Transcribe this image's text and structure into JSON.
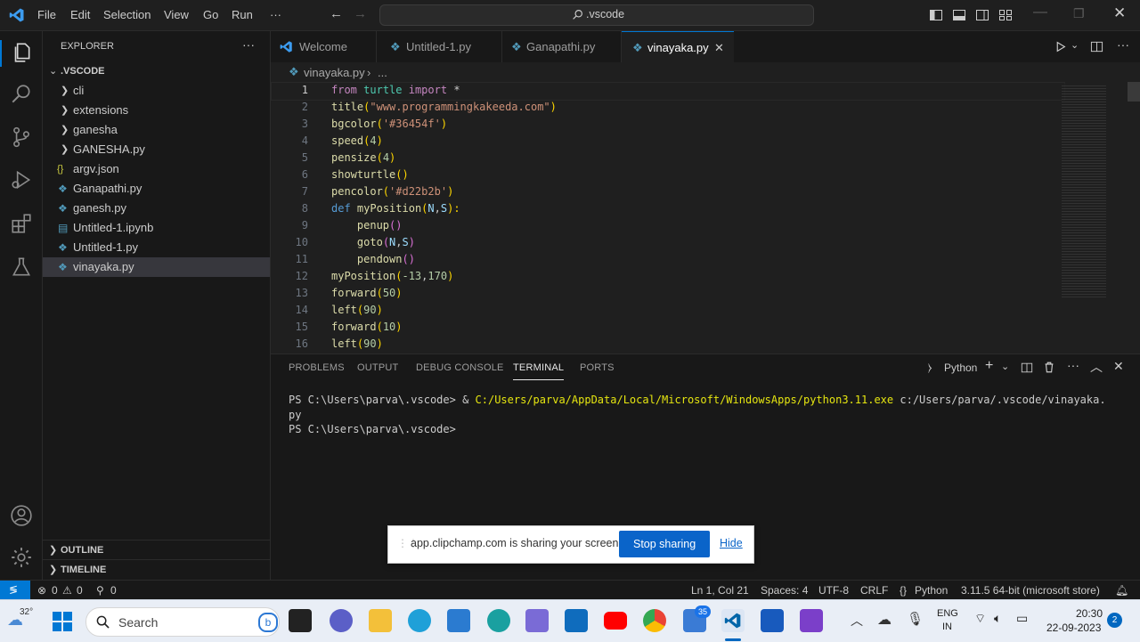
{
  "menu": [
    "File",
    "Edit",
    "Selection",
    "View",
    "Go",
    "Run",
    "···"
  ],
  "search": {
    "text": ".vscode"
  },
  "explorer": {
    "title": "EXPLORER",
    "more": "···",
    "root": ".VSCODE",
    "items": [
      {
        "label": "cli",
        "type": "folder"
      },
      {
        "label": "extensions",
        "type": "folder"
      },
      {
        "label": "ganesha",
        "type": "folder"
      },
      {
        "label": "GANESHA.py",
        "type": "folder"
      },
      {
        "label": "argv.json",
        "type": "json"
      },
      {
        "label": "Ganapathi.py",
        "type": "py"
      },
      {
        "label": "ganesh.py",
        "type": "py"
      },
      {
        "label": "Untitled-1.ipynb",
        "type": "ipynb"
      },
      {
        "label": "Untitled-1.py",
        "type": "py"
      },
      {
        "label": "vinayaka.py",
        "type": "py"
      }
    ],
    "outline": "OUTLINE",
    "timeline": "TIMELINE"
  },
  "tabs": [
    "Welcome",
    "Untitled-1.py",
    "Ganapathi.py",
    "vinayaka.py"
  ],
  "breadcrumb": {
    "file": "vinayaka.py",
    "rest": "..."
  },
  "code": {
    "line1": [
      "from",
      "turtle",
      "import",
      "*"
    ],
    "line2": [
      "title",
      "(",
      "\"www.programmingkakeeda.com\"",
      ")"
    ],
    "line3": [
      "bgcolor",
      "(",
      "'#36454f'",
      ")"
    ],
    "line4": [
      "speed",
      "(",
      "4",
      ")"
    ],
    "line5": [
      "pensize",
      "(",
      "4",
      ")"
    ],
    "line6": [
      "showturtle",
      "()"
    ],
    "line7": [
      "pencolor",
      "(",
      "'#d22b2b'",
      ")"
    ],
    "line8": [
      "def",
      "myPosition",
      "(",
      "N",
      ",",
      "S",
      "):"
    ],
    "line9": [
      "penup",
      "()"
    ],
    "line10": [
      "goto",
      "(",
      "N",
      ",",
      "S",
      ")"
    ],
    "line11": [
      "pendown",
      "()"
    ],
    "line12": [
      "myPosition",
      "(",
      "-13",
      ",",
      "170",
      ")"
    ],
    "line13": [
      "forward",
      "(",
      "50",
      ")"
    ],
    "line14": [
      "left",
      "(",
      "90",
      ")"
    ],
    "line15": [
      "forward",
      "(",
      "10",
      ")"
    ],
    "line16": [
      "left",
      "(",
      "90",
      ")"
    ]
  },
  "panel": {
    "tabs": [
      "PROBLEMS",
      "OUTPUT",
      "DEBUG CONSOLE",
      "TERMINAL",
      "PORTS"
    ],
    "shell": "Python",
    "lines": {
      "prompt1": "PS C:\\Users\\parva\\.vscode> &",
      "exe": "C:/Users/parva/AppData/Local/Microsoft/WindowsApps/python3.11.exe",
      "arg": "c:/Users/parva/.vscode/vinayaka.",
      "wrap": "py",
      "prompt2": "PS C:\\Users\\parva\\.vscode>"
    }
  },
  "status": {
    "errors": "0",
    "warnings": "0",
    "ports": "0",
    "position": "Ln 1, Col 21",
    "spaces": "Spaces: 4",
    "encoding": "UTF-8",
    "eol": "CRLF",
    "language": "Python",
    "interpreter": "3.11.5 64-bit (microsoft store)"
  },
  "share": {
    "message": "app.clipchamp.com is sharing your screen.",
    "stop": "Stop sharing",
    "hide": "Hide"
  },
  "taskbar": {
    "weather": "32°",
    "search": "Search",
    "store_badge": "35",
    "lang1": "ENG",
    "lang2": "IN",
    "time": "20:30",
    "date": "22-09-2023",
    "notif": "2"
  },
  "colors": {
    "accent": "#0078d4",
    "activity_bg": "#181818",
    "editor_bg": "#1f1f1f"
  }
}
